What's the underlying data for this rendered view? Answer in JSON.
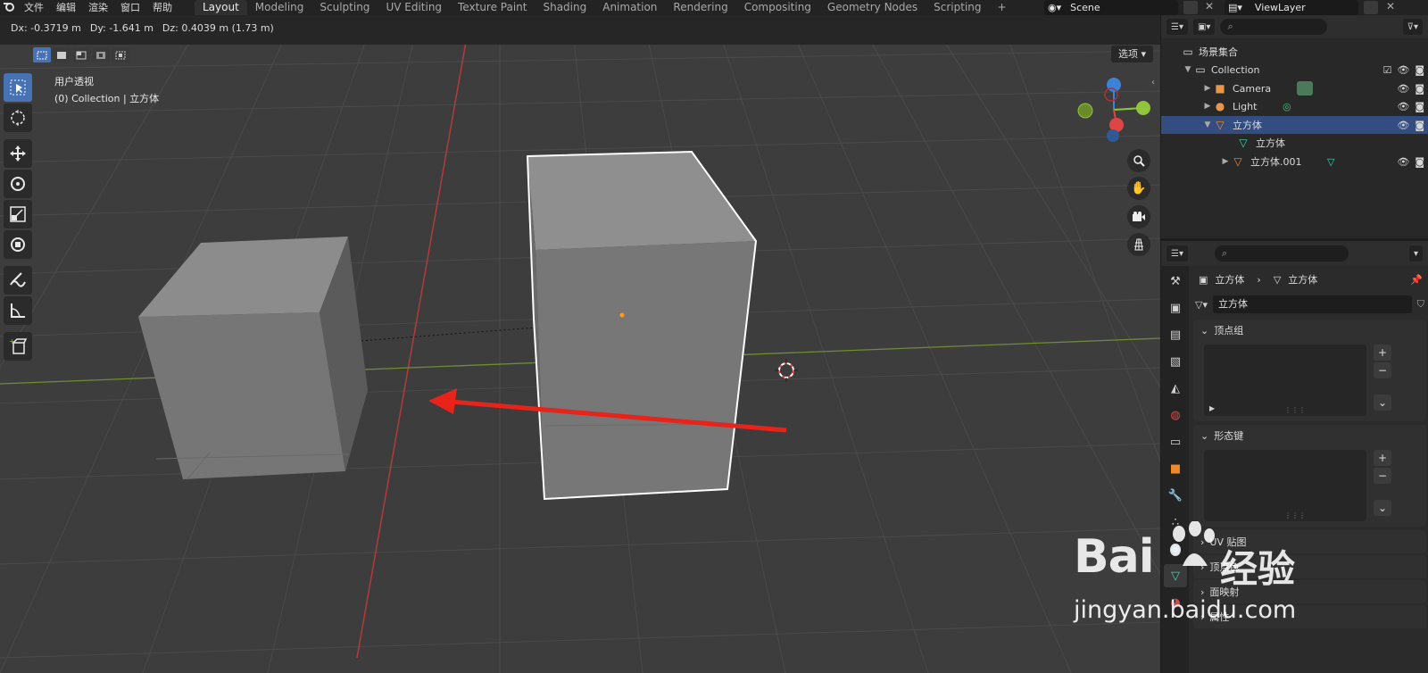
{
  "menu": [
    "文件",
    "编辑",
    "渲染",
    "窗口",
    "帮助"
  ],
  "workspaces": [
    "Layout",
    "Modeling",
    "Sculpting",
    "UV Editing",
    "Texture Paint",
    "Shading",
    "Animation",
    "Rendering",
    "Compositing",
    "Geometry Nodes",
    "Scripting",
    "+"
  ],
  "active_workspace": "Layout",
  "scene_name": "Scene",
  "view_layer": "ViewLayer",
  "viewport": {
    "status": {
      "dx": "Dx: -0.3719 m",
      "dy": "Dy: -1.641 m",
      "dz": "Dz: 0.4039 m (1.73 m)"
    },
    "options_label": "选项",
    "view_name": "用户透视",
    "context": "(0) Collection | 立方体",
    "gizmo": {
      "z": "Z",
      "y": "Y",
      "x": "X"
    }
  },
  "outliner": {
    "search_placeholder": "",
    "rows": [
      {
        "label": "场景集合",
        "icon": "scene-collection-icon"
      },
      {
        "label": "Collection",
        "icon": "collection-icon"
      },
      {
        "label": "Camera",
        "icon": "camera-icon"
      },
      {
        "label": "Light",
        "icon": "light-icon"
      },
      {
        "label": "立方体",
        "icon": "mesh-object-icon",
        "selected": true
      },
      {
        "label": "立方体",
        "icon": "mesh-data-icon"
      },
      {
        "label": "立方体.001",
        "icon": "mesh-object-icon"
      }
    ]
  },
  "properties": {
    "breadcrumb_object": "立方体",
    "breadcrumb_data": "立方体",
    "datablock_name": "立方体",
    "panels": {
      "vertex_groups": "顶点组",
      "shape_keys": "形态键"
    },
    "sub_rows": [
      "UV 贴图",
      "顶点色",
      "面映射",
      "属性"
    ]
  },
  "watermark": {
    "brand": "Bai",
    "brand_cn": "经验",
    "url": "jingyan.baidu.com"
  },
  "colors": {
    "accent": "#4772b3",
    "selected_row": "#334d80",
    "arrow": "#e8231a",
    "x_axis": "#e04545",
    "y_axis": "#8fc43c",
    "z_axis": "#3d82d6"
  }
}
